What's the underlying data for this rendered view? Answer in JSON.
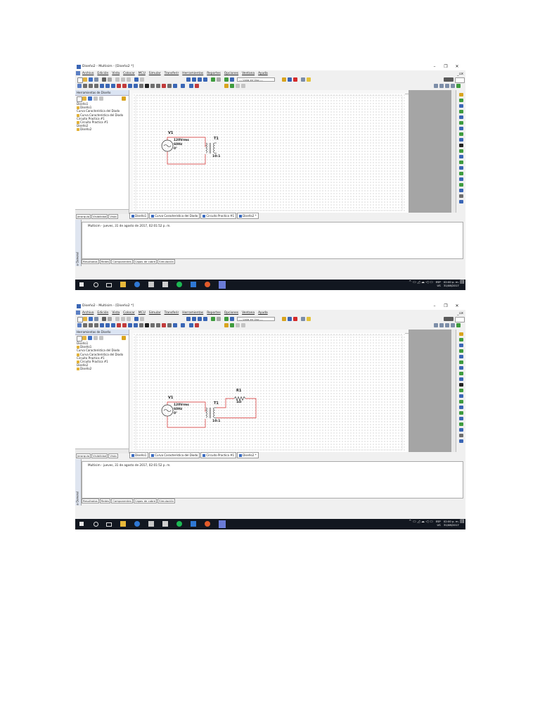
{
  "app": {
    "title": "Diseño2 - Multisim - [Diseño2 *]",
    "win_min": "–",
    "win_max": "❐",
    "win_close": "✕",
    "mdi_controls": "_▫x"
  },
  "menu": [
    "Archivo",
    "Edición",
    "Vista",
    "Colocar",
    "MCU",
    "Simular",
    "Transferir",
    "Herramientas",
    "Reportes",
    "Opciones",
    "Ventana",
    "Ayuda"
  ],
  "toolbar": {
    "in_use_combo": "--- Lista en Uso ---"
  },
  "design_toolbox": {
    "title": "Herramientas de Diseño",
    "tree": [
      {
        "label": "Diseño1",
        "type": "folder"
      },
      {
        "label": "Diseño1",
        "type": "file"
      },
      {
        "label": "Curva Característica del Diodo",
        "type": "folder"
      },
      {
        "label": "Curva Característica del Diodo",
        "type": "file"
      },
      {
        "label": "Circuito Practica #1",
        "type": "folder"
      },
      {
        "label": "Circuito Practica #1",
        "type": "file"
      },
      {
        "label": "Diseño2",
        "type": "folder"
      },
      {
        "label": "Diseño2",
        "type": "file"
      }
    ],
    "tabs": [
      "Jerarquía",
      "Visibilidad",
      "Vista"
    ]
  },
  "document_tabs": [
    "Diseño1",
    "Curva Característica del Diodo",
    "Circuito Practica #1",
    "Diseño2 *"
  ],
  "output": {
    "side_label": "Tabla General",
    "message": "Multisim  -  jueves, 31 de agosto de 2017, 02:01:52 p. m.",
    "tabs": [
      "Resultados",
      "Redes",
      "Componentes",
      "Capas de cobre",
      "Simulación"
    ]
  },
  "tray": {
    "lang": "ESP",
    "region": "US",
    "time": "02:00 p. m.",
    "date": "31/08/2017"
  },
  "shots": [
    {
      "circuit": {
        "source": {
          "ref": "V1",
          "voltage": "120Vrms",
          "freq": "60Hz",
          "phase": "0°"
        },
        "transformer": {
          "ref": "T1",
          "ratio": "10:1"
        },
        "resistor": null
      }
    },
    {
      "circuit": {
        "source": {
          "ref": "V1",
          "voltage": "120Vrms",
          "freq": "60Hz",
          "phase": "0°"
        },
        "transformer": {
          "ref": "T1",
          "ratio": "10:1"
        },
        "resistor": {
          "ref": "R1",
          "value": "1Ω"
        }
      }
    }
  ],
  "colors": {
    "wire": "#d42a2a",
    "accent": "#3b6cc1",
    "taskbar": "#121720",
    "component": "#2b2b2b"
  }
}
